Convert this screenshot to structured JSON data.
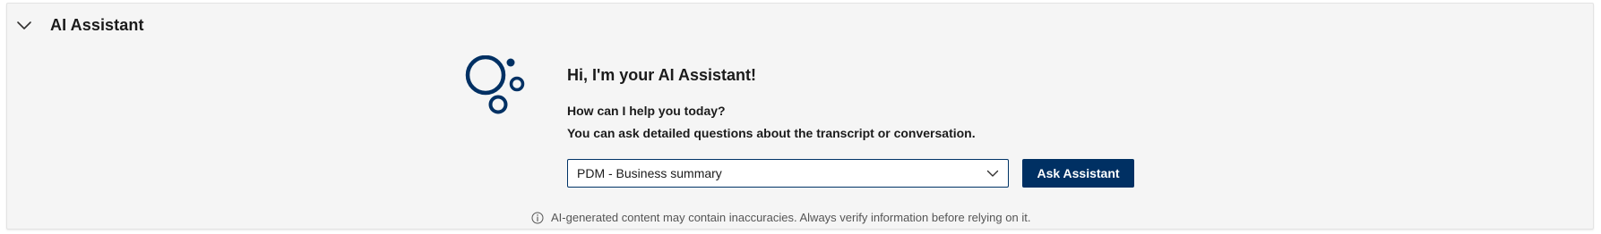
{
  "panel": {
    "title": "AI Assistant",
    "collapse_icon": "chevron-down-icon"
  },
  "assistant": {
    "logo_icon": "bubbles-logo-icon",
    "greeting": "Hi, I'm your AI Assistant!",
    "help_prompt": "How can I help you today?",
    "detail_prompt": "You can ask detailed questions about the transcript or conversation."
  },
  "prompt_select": {
    "selected_value": "PDM - Business summary",
    "icon": "chevron-down-icon"
  },
  "ask_button": {
    "label": "Ask Assistant"
  },
  "disclaimer": {
    "icon": "info-icon",
    "text": "AI-generated content may contain inaccuracies. Always verify information before relying on it."
  },
  "colors": {
    "brand": "#003063",
    "panel_background": "#f5f5f5",
    "border": "#003366"
  }
}
